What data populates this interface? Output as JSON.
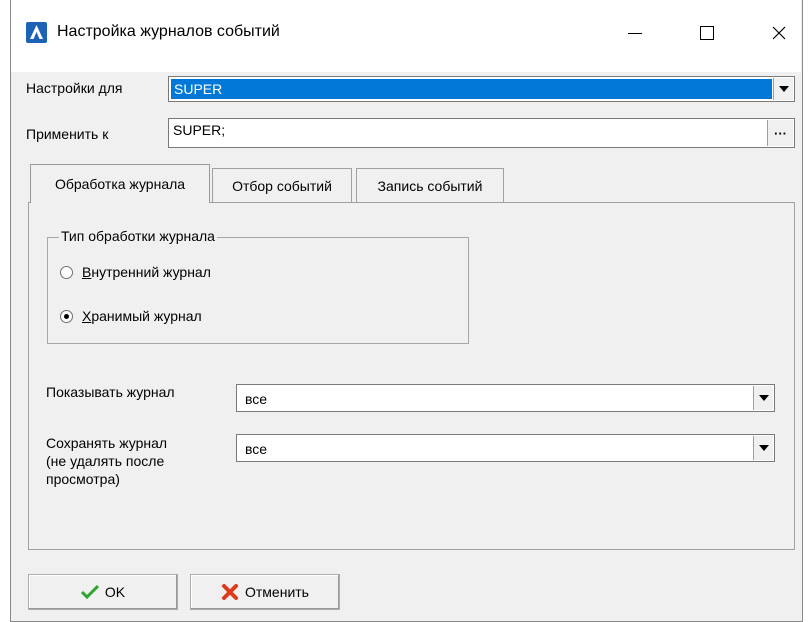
{
  "window": {
    "title": "Настройка журналов событий",
    "minimize_glyph": "—",
    "maximize_glyph": "☐",
    "close_glyph": "✕"
  },
  "settings_for": {
    "label": "Настройки для",
    "value": "SUPER"
  },
  "apply_to": {
    "label": "Применить к",
    "value": "SUPER;",
    "button": "···"
  },
  "tabs": [
    {
      "label": "Обработка журнала",
      "active": true
    },
    {
      "label": "Отбор событий",
      "active": false
    },
    {
      "label": "Запись событий",
      "active": false
    }
  ],
  "processing_type": {
    "title": "Тип обработки журнала",
    "options": [
      {
        "hotkey": "В",
        "rest": "нутренний журнал",
        "selected": false
      },
      {
        "hotkey": "Х",
        "rest": "ранимый журнал",
        "selected": true
      }
    ]
  },
  "show_log": {
    "label": "Показывать журнал",
    "value": "все"
  },
  "save_log": {
    "label_lines": [
      "Сохранять журнал",
      "(не удалять после",
      "просмотра)"
    ],
    "value": "все"
  },
  "buttons": {
    "ok": "OK",
    "cancel": "Отменить"
  },
  "colors": {
    "selection": "#0078d7",
    "ok_check": "#2fa52f",
    "cancel_x": "#e03a1e"
  },
  "icons": {
    "app": "app-logo-icon",
    "ok": "checkmark-icon",
    "cancel": "cross-icon"
  }
}
